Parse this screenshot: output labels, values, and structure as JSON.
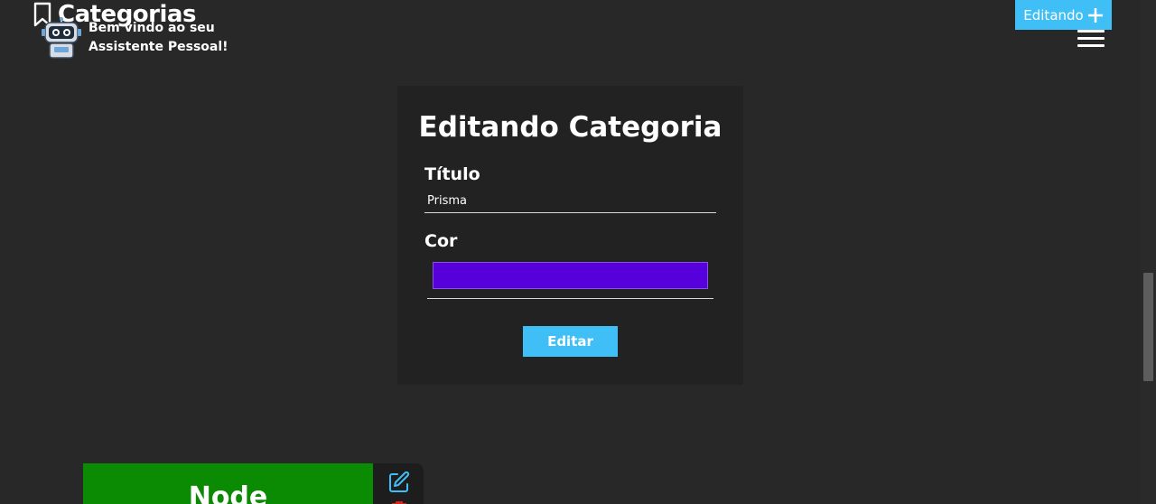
{
  "header": {
    "title": "Categorias",
    "welcome": "Bem vindo ao seu Assistente Pessoal!",
    "new_button_label": "Editando",
    "icons": {
      "title": "bookmark-icon",
      "brand": "robot-icon",
      "new": "plus-icon",
      "menu": "hamburger-menu-icon"
    }
  },
  "form": {
    "title": "Editando Categoria",
    "title_label": "Título",
    "title_value": "Prisma",
    "color_label": "Cor",
    "color_value": "#5600dc",
    "submit_label": "Editar"
  },
  "categories": [
    {
      "name": "Node",
      "color": "#0b8a04",
      "actions": [
        "edit-icon",
        "trash-icon"
      ]
    }
  ],
  "colors": {
    "background": "#282828",
    "card": "#222222",
    "accent": "#3fbff5",
    "edit_icon": "#3fbff5",
    "delete_icon": "#e02020"
  }
}
